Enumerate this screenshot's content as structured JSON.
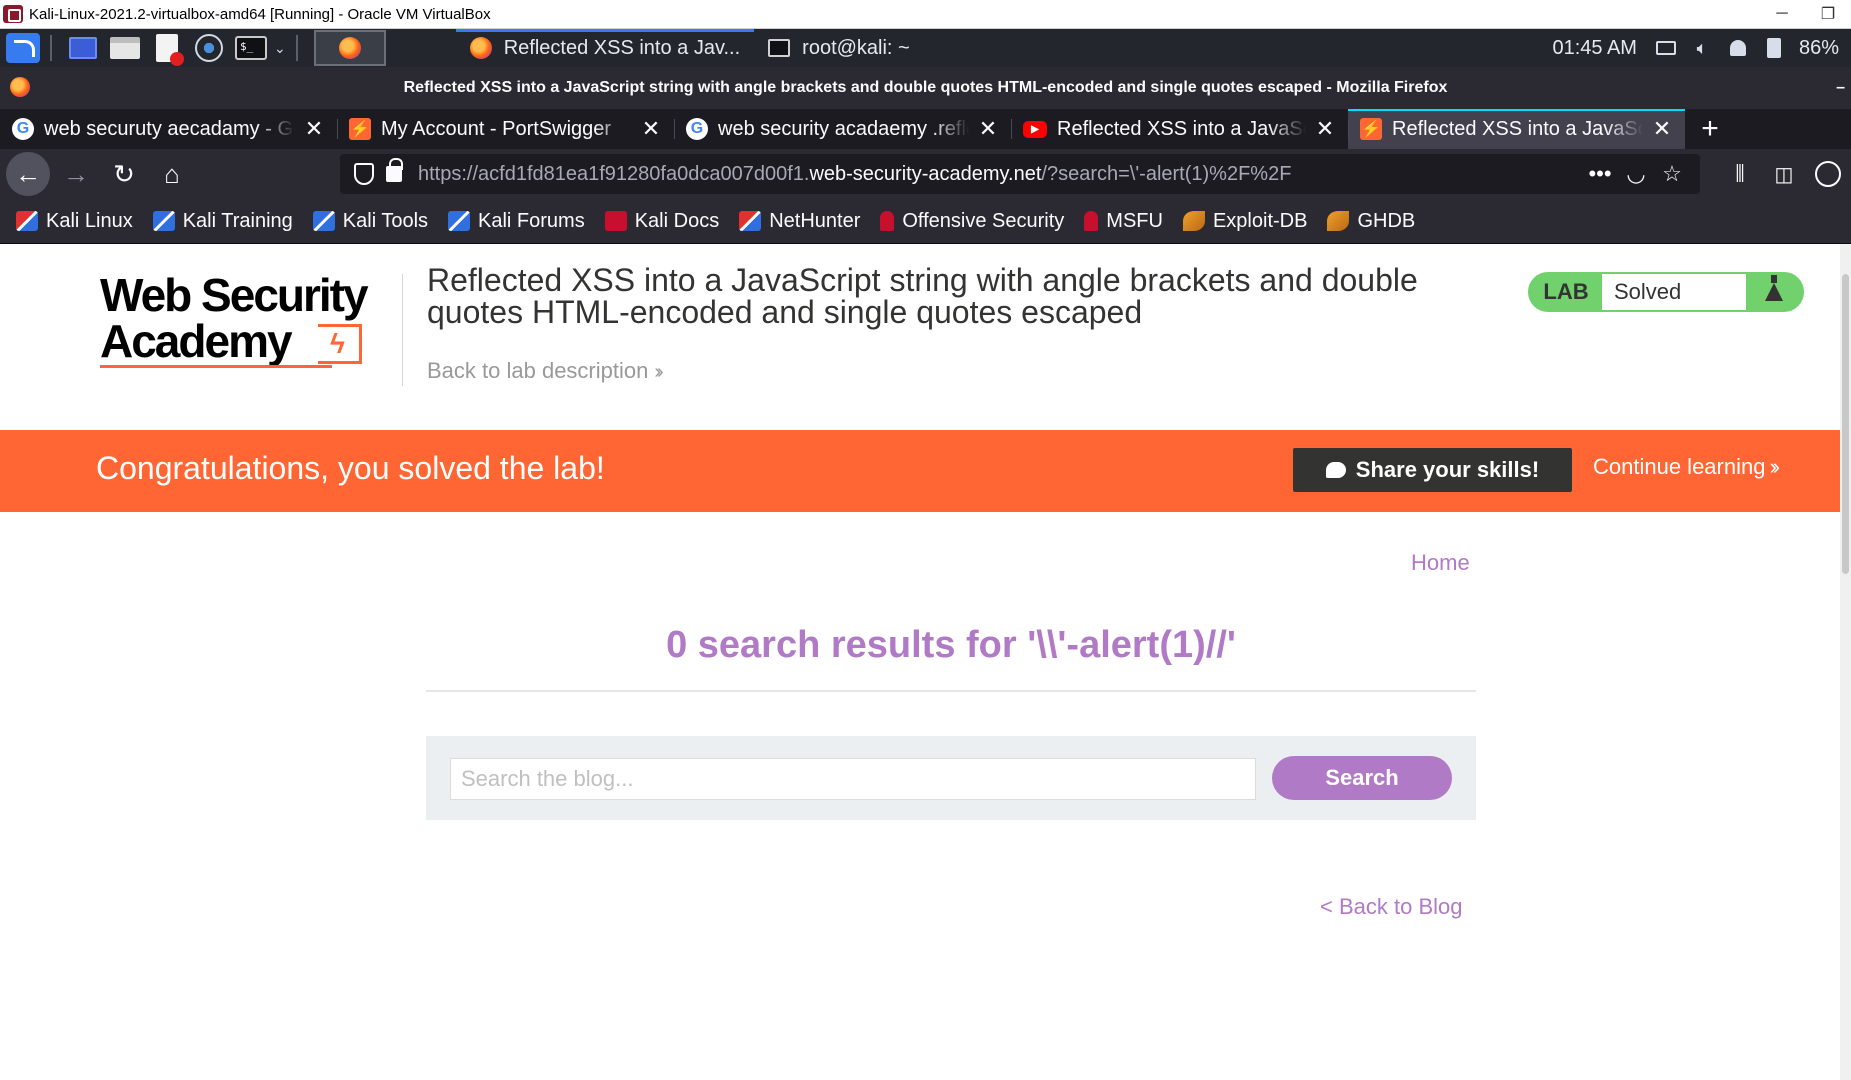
{
  "vbox": {
    "title": "Kali-Linux-2021.2-virtualbox-amd64 [Running] - Oracle VM VirtualBox",
    "minimize": "─",
    "restore": "❐"
  },
  "panel": {
    "tasks": [
      {
        "label": "Reflected XSS into a Jav...",
        "icon": "firefox-icon"
      },
      {
        "label": "root@kali: ~",
        "icon": "terminal-icon"
      }
    ],
    "clock": "01:45 AM",
    "battery": "86%"
  },
  "firefox": {
    "window_title": "Reflected XSS into a JavaScript string with angle brackets and double quotes HTML-encoded and single quotes escaped - Mozilla Firefox",
    "tabs": [
      {
        "label": "web securuty aecadamy - Go",
        "favicon": "G",
        "close": "✕"
      },
      {
        "label": "My Account - PortSwigger",
        "favicon": "⚡",
        "close": "✕"
      },
      {
        "label": "web security acadaemy .reflect",
        "favicon": "G",
        "close": "✕"
      },
      {
        "label": "Reflected XSS into a JavaSc",
        "favicon": "▶",
        "close": "✕"
      },
      {
        "label": "Reflected XSS into a JavaScr",
        "favicon": "⚡",
        "close": "✕"
      }
    ],
    "new_tab": "+",
    "url": {
      "prefix": "https://acfd1fd81ea1f91280fa0dca007d00f1.",
      "host": "web-security-academy.net",
      "suffix": "/?search=\\'-alert(1)%2F%2F"
    },
    "page_actions": "•••",
    "bookmarks": [
      "Kali Linux",
      "Kali Training",
      "Kali Tools",
      "Kali Forums",
      "Kali Docs",
      "NetHunter",
      "Offensive Security",
      "MSFU",
      "Exploit-DB",
      "GHDB"
    ]
  },
  "lab": {
    "logo_line1": "Web Security",
    "logo_line2": "Academy",
    "title": "Reflected XSS into a JavaScript string with angle brackets and double quotes HTML-encoded and single quotes escaped",
    "back_to_description": "Back to lab description",
    "status_tag": "LAB",
    "status": "Solved",
    "status_color": "#70d16d",
    "congrats": "Congratulations, you solved the lab!",
    "share": "Share your skills!",
    "continue": "Continue learning",
    "banner_color": "#ff6633"
  },
  "blog": {
    "home": "Home",
    "results_title": "0 search results for '\\\\'-alert(1)//'",
    "search_placeholder": "Search the blog...",
    "search_button": "Search",
    "back_to_blog": "< Back to Blog",
    "accent_color": "#b17ac6"
  }
}
